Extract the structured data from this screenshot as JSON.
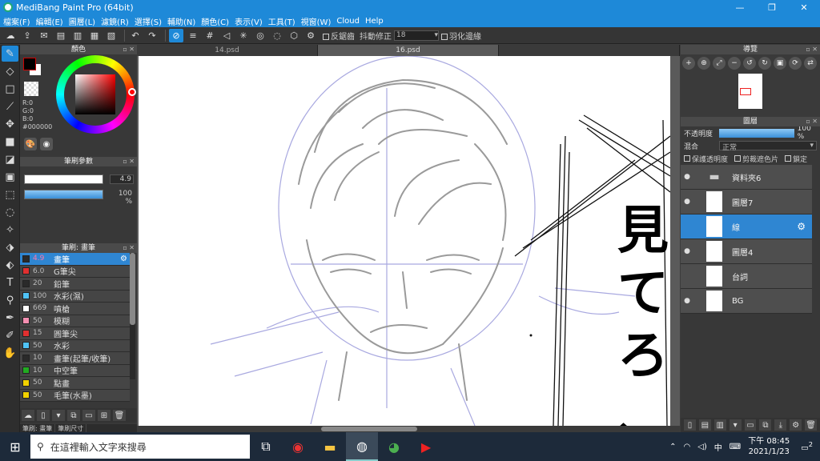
{
  "window": {
    "title": "MediBang Paint Pro (64bit)",
    "minimize": "—",
    "maximize": "❐",
    "close": "✕"
  },
  "menu": [
    "檔案(F)",
    "編輯(E)",
    "圖層(L)",
    "選擇(S)",
    "選擇(S)",
    "輔助(N)",
    "顏色(C)",
    "表示(V)",
    "工具(T)",
    "視窗(W)",
    "Cloud",
    "Help"
  ],
  "menu_fixed": [
    "檔案(F)",
    "編輯(E)",
    "圖層(L)",
    "濾鏡(R)",
    "選擇(S)",
    "輔助(N)",
    "顏色(C)",
    "表示(V)",
    "工具(T)",
    "視窗(W)",
    "Cloud",
    "Help"
  ],
  "toolbar": {
    "antialias": "反鋸齒",
    "stabilizer": "抖動修正",
    "stabilizer_value": "18",
    "feather": "羽化邊緣"
  },
  "color_panel": {
    "title": "顏色",
    "r": "R:0",
    "g": "G:0",
    "b": "B:0",
    "hex": "#000000"
  },
  "brush_param": {
    "title": "筆刷參數",
    "size": "4.9",
    "opacity": "100 %"
  },
  "brush_list": {
    "title": "筆刷: 畫筆",
    "items": [
      {
        "size": "4.9",
        "name": "畫筆",
        "color": "#2a2a2a"
      },
      {
        "size": "6.0",
        "name": "G筆尖",
        "color": "#e03030"
      },
      {
        "size": "20",
        "name": "鉛筆",
        "color": "#2a2a2a"
      },
      {
        "size": "100",
        "name": "水彩(濕)",
        "color": "#4fc3f7"
      },
      {
        "size": "669",
        "name": "噴槍",
        "color": "#ffffff"
      },
      {
        "size": "50",
        "name": "模糊",
        "color": "#f48fb1"
      },
      {
        "size": "15",
        "name": "圓筆尖",
        "color": "#e03030"
      },
      {
        "size": "50",
        "name": "水彩",
        "color": "#4fc3f7"
      },
      {
        "size": "10",
        "name": "畫筆(起筆/收筆)",
        "color": "#2a2a2a"
      },
      {
        "size": "10",
        "name": "中空筆",
        "color": "#22aa22"
      },
      {
        "size": "50",
        "name": "點畫",
        "color": "#f2d200"
      },
      {
        "size": "50",
        "name": "毛筆(水墨)",
        "color": "#f2d200"
      }
    ]
  },
  "bottom_tabs": [
    "筆刷: 畫筆",
    "筆刷尺寸"
  ],
  "tabs": [
    "14.psd",
    "16.psd",
    ""
  ],
  "manga_text": [
    "見",
    "て",
    "ろ",
    "、"
  ],
  "navigator": {
    "title": "導覽"
  },
  "layers": {
    "title": "圖層",
    "opacity_label": "不透明度",
    "opacity_value": "100 %",
    "blend_label": "混合",
    "blend_value": "正常",
    "protect_alpha": "保護透明度",
    "clipping": "剪裁遮色片",
    "lock": "鎖定",
    "items": [
      {
        "name": "資料夾6",
        "kind": "folder"
      },
      {
        "name": "圖層7",
        "kind": "layer"
      },
      {
        "name": "線",
        "kind": "layer"
      },
      {
        "name": "圖層4",
        "kind": "layer"
      },
      {
        "name": "台詞",
        "kind": "layer"
      },
      {
        "name": "BG",
        "kind": "layer"
      }
    ]
  },
  "taskbar": {
    "search_placeholder": "在這裡輸入文字來搜尋",
    "time": "下午 08:45",
    "date": "2021/1/23",
    "notif": "2"
  },
  "colors": {
    "accent": "#1e89d8",
    "selected_row": "#2f86d2",
    "sketch": "#9a9a9a",
    "guide": "#a9a9e0"
  }
}
